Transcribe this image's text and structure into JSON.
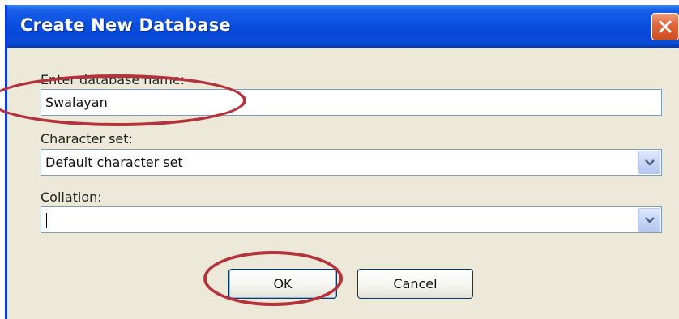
{
  "dialog": {
    "title": "Create New Database"
  },
  "form": {
    "name_label": "Enter database name:",
    "name_value": "Swalayan",
    "charset_label": "Character set:",
    "charset_value": "Default character set",
    "collation_label": "Collation:",
    "collation_value": ""
  },
  "buttons": {
    "ok_label": "OK",
    "cancel_label": "Cancel"
  },
  "colors": {
    "titlebar": "#0a4fe0",
    "dialog_background": "#ece9d8",
    "annotation_circle": "#b3323c"
  },
  "icons": {
    "close": "close-icon",
    "dropdown": "chevron-down-icon"
  }
}
